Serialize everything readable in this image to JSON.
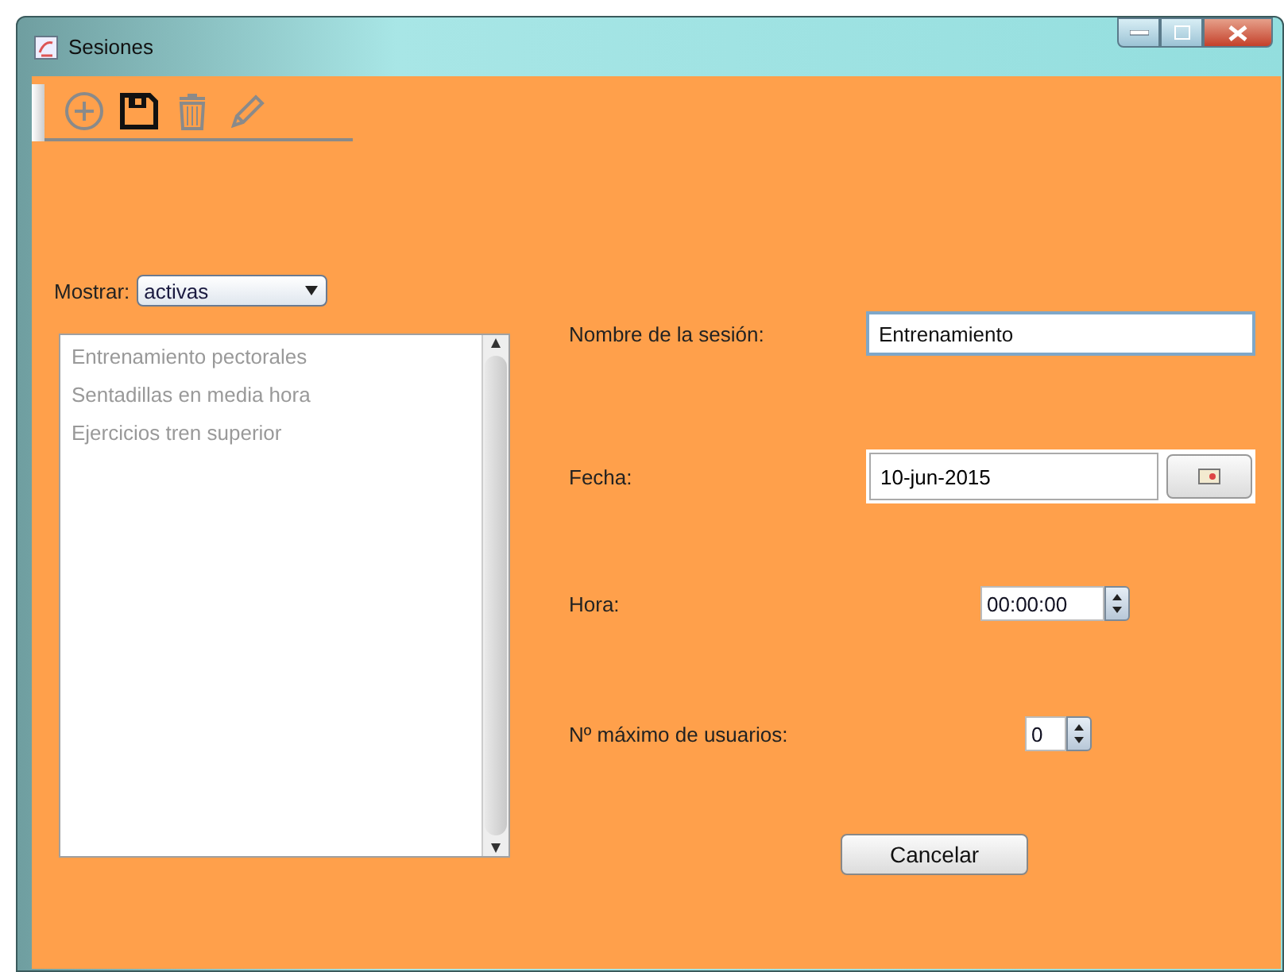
{
  "window": {
    "title": "Sesiones"
  },
  "toolbar": [
    {
      "kind": "add",
      "disabled": true
    },
    {
      "kind": "save",
      "disabled": false
    },
    {
      "kind": "delete",
      "disabled": true
    },
    {
      "kind": "edit",
      "disabled": true
    }
  ],
  "filter": {
    "label": "Mostrar:",
    "value": "activas"
  },
  "sessions_list": {
    "disabled": true,
    "items": [
      "Entrenamiento pectorales",
      "Sentadillas en media hora",
      "Ejercicios tren superior"
    ]
  },
  "form": {
    "name": {
      "label": "Nombre de la sesión:",
      "value": "Entrenamiento"
    },
    "date": {
      "label": "Fecha:",
      "value": "10-jun-2015"
    },
    "time": {
      "label": "Hora:",
      "value": "00:00:00"
    },
    "max_users": {
      "label": "Nº máximo de usuarios:",
      "value": "0"
    }
  },
  "buttons": [
    "Cancelar"
  ]
}
